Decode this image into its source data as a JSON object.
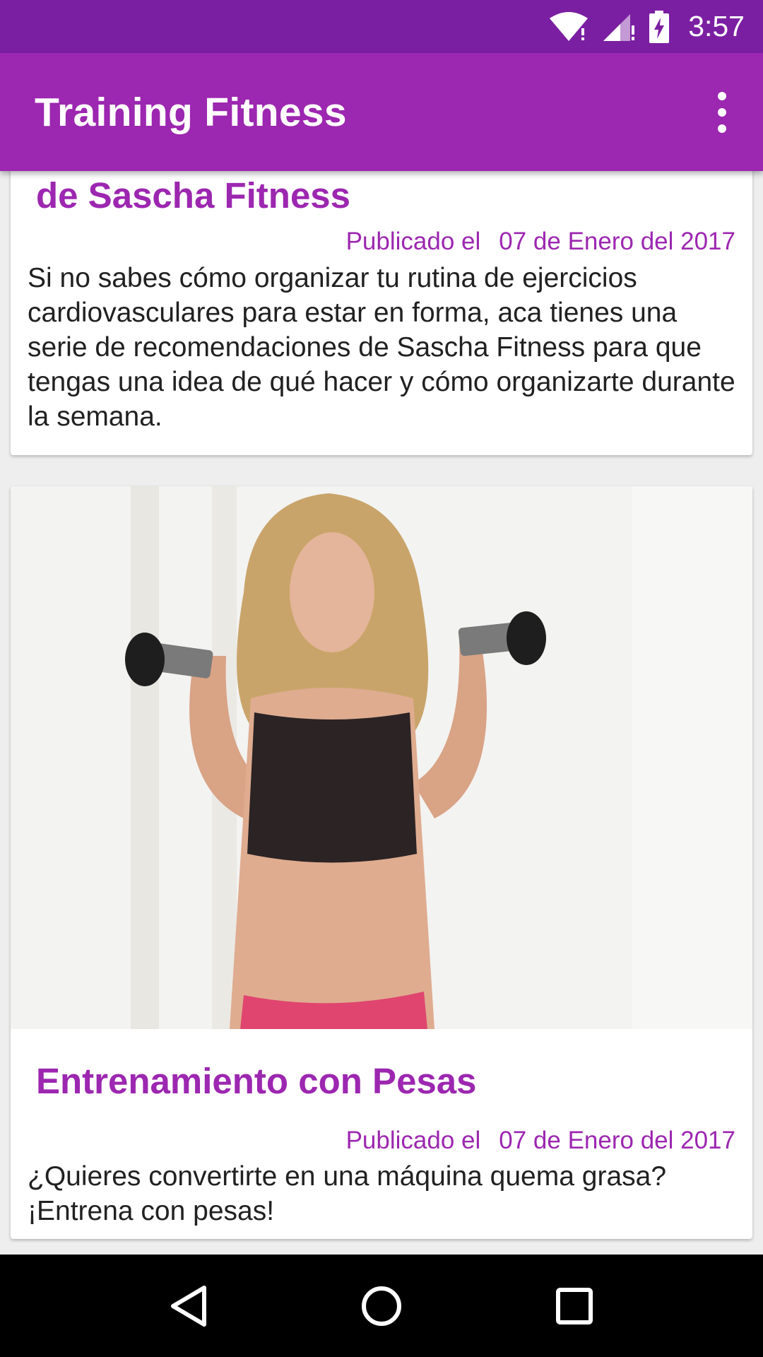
{
  "status_bar": {
    "time": "3:57"
  },
  "app_bar": {
    "title": "Training Fitness"
  },
  "articles": [
    {
      "title": "de Sascha Fitness",
      "published_label": "Publicado el",
      "date": "07 de Enero del 2017",
      "summary": "Si no sabes cómo organizar tu rutina de ejercicios cardiovasculares para estar en forma, aca tienes una serie de recomendaciones de Sascha Fitness  para que tengas una idea de qué hacer y cómo organizarte durante la semana."
    },
    {
      "title": "Entrenamiento con Pesas",
      "published_label": "Publicado el",
      "date": "07 de Enero del 2017",
      "summary": "¿Quieres convertirte en una máquina quema grasa? ¡Entrena con pesas!"
    }
  ],
  "colors": {
    "status_bar": "#7b1fa2",
    "app_bar": "#9c27b0",
    "accent_text": "#9c27b0",
    "body_text": "#212121"
  }
}
